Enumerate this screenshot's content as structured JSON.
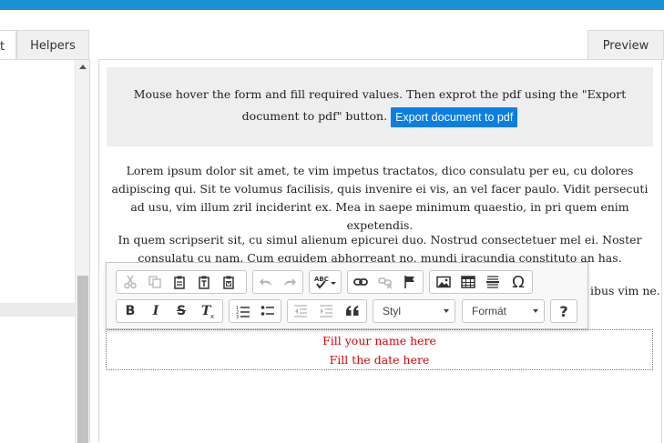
{
  "left_tabs": {
    "partial_label": "t",
    "helpers_label": "Helpers"
  },
  "preview_tab": {
    "label": "Preview"
  },
  "info_box": {
    "text": "Mouse hover the form and fill required values. Then exprot the pdf using the \"Export document to pdf\" button.",
    "button_label": "Export document to pdf"
  },
  "paragraphs": {
    "p1": "Lorem ipsum dolor sit amet, te vim impetus tractatos, dico consulatu per eu, cu dolores adipiscing qui. Sit te volumus facilisis, quis invenire ei vis, an vel facer paulo. Vidit persecuti ad usu, vim illum zril inciderint ex. Mea in saepe minimum quaestio, in pri quem enim expetendis.",
    "p2": "In quem scripserit sit, cu simul alienum epicurei duo. Nostrud consectetuer mel ei. Noster consulatu cu nam. Cum equidem abhorreant no, mundi iracundia constituto an has.",
    "p3_fragment": "ibus vim ne."
  },
  "editable": {
    "line1": "Fill your name here",
    "line2": "Fill the date here"
  },
  "toolbar": {
    "style_combo": "Styl",
    "format_combo": "Formát",
    "help_label": "?",
    "icons": [
      "cut-icon",
      "copy-icon",
      "paste-icon",
      "paste-text-icon",
      "paste-word-icon",
      "undo-icon",
      "redo-icon",
      "spellcheck-icon",
      "link-icon",
      "unlink-icon",
      "anchor-icon",
      "image-icon",
      "table-icon",
      "horizontal-rule-icon",
      "special-char-icon",
      "bold-icon",
      "italic-icon",
      "strike-icon",
      "remove-format-icon",
      "numbered-list-icon",
      "bulleted-list-icon",
      "outdent-icon",
      "indent-icon",
      "blockquote-icon"
    ]
  },
  "colors": {
    "accent": "#1a91d4",
    "button": "#0a7fe0",
    "placeholder_text": "#dd0000"
  }
}
